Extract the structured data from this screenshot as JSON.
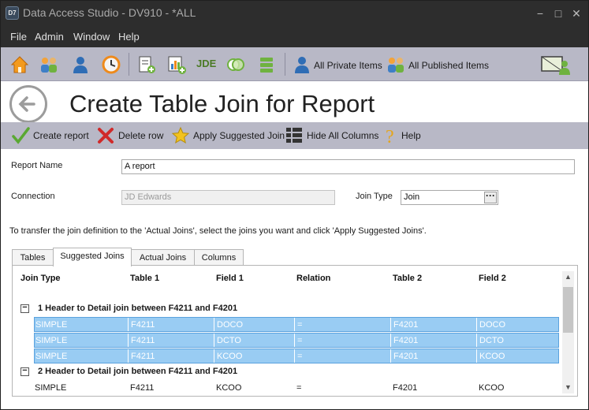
{
  "window": {
    "title": "Data Access Studio - DV910 - *ALL",
    "app_badge": "D7",
    "controls": {
      "minimize": "−",
      "maximize": "□",
      "close": "✕"
    }
  },
  "menubar": {
    "items": [
      "File",
      "Admin",
      "Window",
      "Help"
    ]
  },
  "toolbar": {
    "jde_label": "JDE",
    "all_private_label": "All Private Items",
    "all_published_label": "All Published Items"
  },
  "header": {
    "title": "Create Table Join for Report"
  },
  "actions": {
    "create_report": "Create report",
    "delete_row": "Delete row",
    "apply_suggested": "Apply Suggested Join",
    "hide_columns": "Hide All Columns",
    "help": "Help"
  },
  "form": {
    "report_name_label": "Report Name",
    "report_name_value": "A report",
    "connection_label": "Connection",
    "connection_value": "JD Edwards",
    "join_type_label": "Join Type",
    "join_type_value": "Join",
    "join_type_button": "···"
  },
  "instructions": "To transfer the join definition to the 'Actual Joins', select the joins you want and click 'Apply Suggested Joins'.",
  "tabs": [
    "Tables",
    "Suggested Joins",
    "Actual Joins",
    "Columns"
  ],
  "grid": {
    "columns": [
      "Join Type",
      "Table 1",
      "Field 1",
      "Relation",
      "Table 2",
      "Field 2"
    ],
    "expander_symbol": "−",
    "groups": [
      {
        "label": "1 Header to Detail join between F4211 and F4201",
        "rows": [
          [
            "SIMPLE",
            "F4211",
            "DOCO",
            "=",
            "F4201",
            "DOCO"
          ],
          [
            "SIMPLE",
            "F4211",
            "DCTO",
            "=",
            "F4201",
            "DCTO"
          ],
          [
            "SIMPLE",
            "F4211",
            "KCOO",
            "=",
            "F4201",
            "KCOO"
          ]
        ]
      },
      {
        "label": "2 Header to Detail join between F4211 and F4201",
        "rows": [
          [
            "SIMPLE",
            "F4211",
            "KCOO",
            "=",
            "F4201",
            "KCOO"
          ]
        ]
      }
    ],
    "scroll_up": "▲",
    "scroll_down": "▼"
  }
}
